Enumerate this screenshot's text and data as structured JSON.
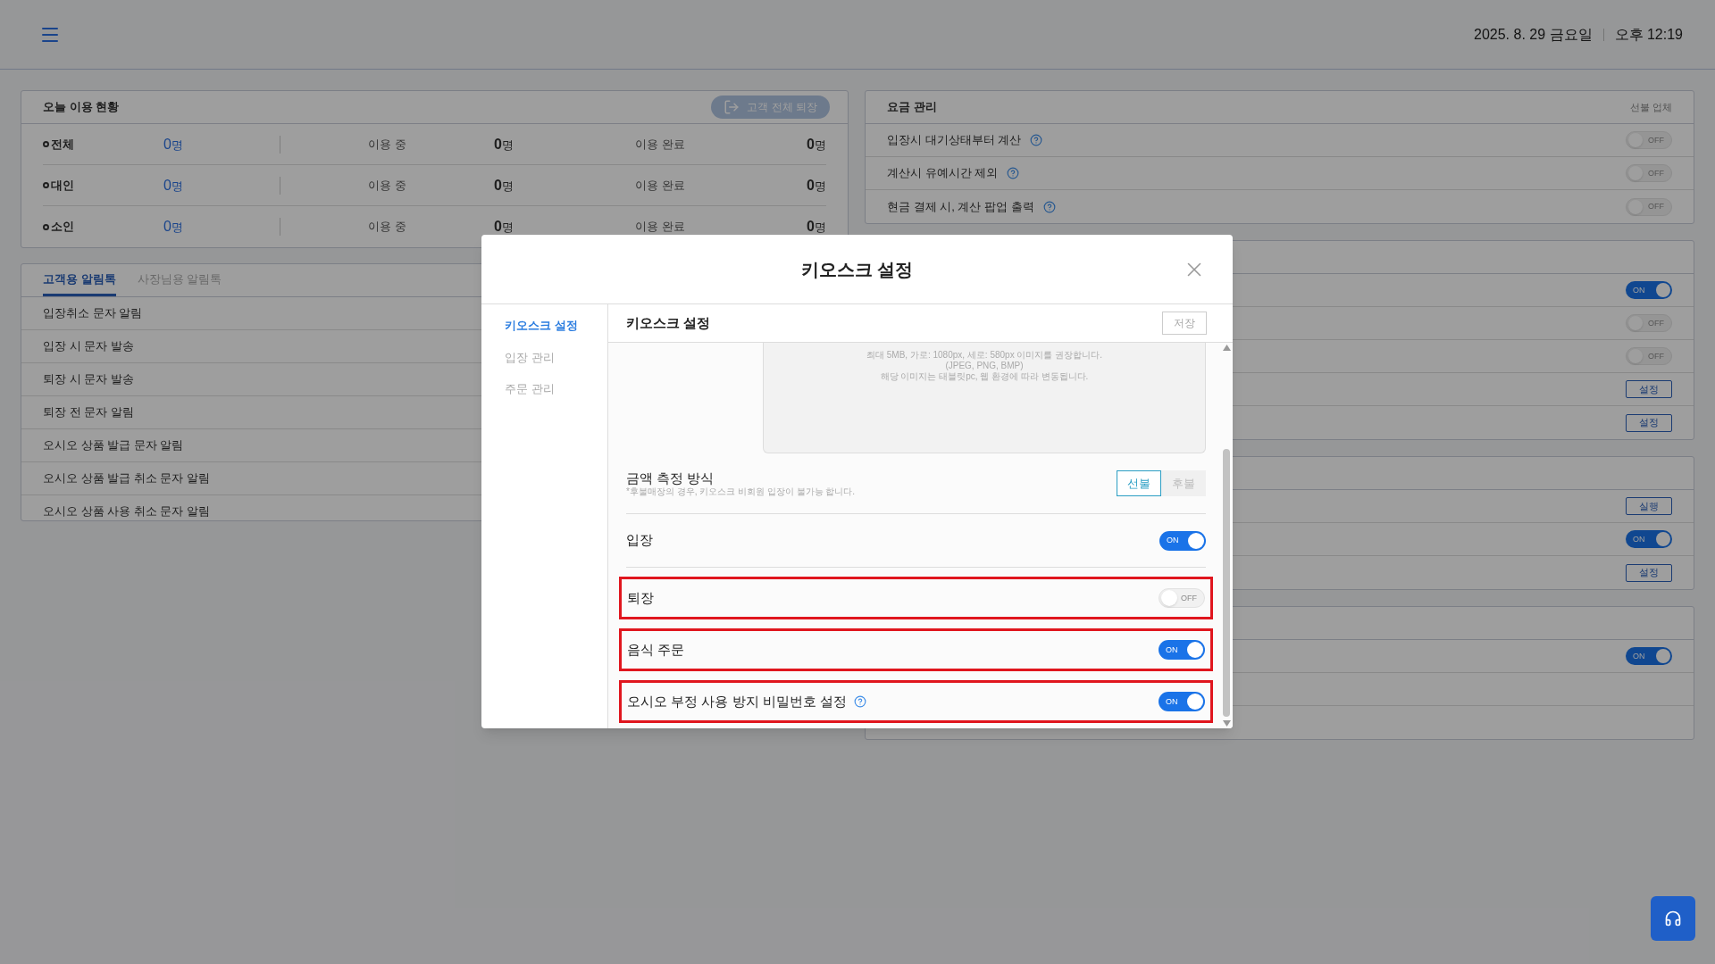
{
  "header": {
    "date": "2025. 8. 29 금요일",
    "time": "오후 12:19"
  },
  "usage_panel": {
    "title": "오늘 이용 현황",
    "exit_all_button": "고객 전체 퇴장",
    "rows": [
      {
        "label": "전체",
        "total_count": "0",
        "total_unit": "명",
        "in_use_label": "이용 중",
        "in_use_count": "0",
        "in_use_unit": "명",
        "done_label": "이용 완료",
        "done_count": "0",
        "done_unit": "명"
      },
      {
        "label": "대인",
        "total_count": "0",
        "total_unit": "명",
        "in_use_label": "이용 중",
        "in_use_count": "0",
        "in_use_unit": "명",
        "done_label": "이용 완료",
        "done_count": "0",
        "done_unit": "명"
      },
      {
        "label": "소인",
        "total_count": "0",
        "total_unit": "명",
        "in_use_label": "이용 중",
        "in_use_count": "0",
        "in_use_unit": "명",
        "done_label": "이용 완료",
        "done_count": "0",
        "done_unit": "명"
      }
    ]
  },
  "notification_panel": {
    "tabs": [
      {
        "label": "고객용 알림톡",
        "selected": true
      },
      {
        "label": "사장님용 알림톡",
        "selected": false
      }
    ],
    "items": [
      "입장취소 문자 알림",
      "입장 시 문자 발송",
      "퇴장 시 문자 발송",
      "퇴장 전 문자 알림",
      "오시오 상품 발급 문자 알림",
      "오시오 상품 발급 취소 문자 알림",
      "오시오 상품 사용 취소 문자 알림"
    ]
  },
  "fee_panel": {
    "title": "요금 관리",
    "note": "선불 업체",
    "rows": [
      {
        "label": "입장시 대기상태부터 계산",
        "help": true,
        "toggle": {
          "on": false,
          "label": "OFF"
        }
      },
      {
        "label": "계산시 유예시간 제외",
        "help": true,
        "toggle": {
          "on": false,
          "label": "OFF"
        }
      },
      {
        "label": "현금 결제 시, 계산 팝업 출력",
        "help": true,
        "toggle": {
          "on": false,
          "label": "OFF"
        }
      }
    ]
  },
  "other_panels": [
    {
      "rows": [
        {
          "kind": "toggle",
          "on": true,
          "label": "ON"
        },
        {
          "kind": "toggle",
          "on": false,
          "label": "OFF"
        },
        {
          "kind": "toggle",
          "on": false,
          "label": "OFF"
        },
        {
          "kind": "button",
          "label": "설정"
        },
        {
          "kind": "button",
          "label": "설정"
        }
      ]
    },
    {
      "rows": [
        {
          "kind": "button",
          "label": "실행"
        },
        {
          "kind": "toggle",
          "on": true,
          "label": "ON"
        },
        {
          "kind": "button",
          "label": "설정"
        }
      ]
    },
    {
      "rows": [
        {
          "kind": "toggle",
          "on": true,
          "label": "ON"
        },
        {
          "kind": "blank"
        },
        {
          "kind": "blank"
        }
      ]
    }
  ],
  "modal": {
    "title": "키오스크 설정",
    "menu": [
      {
        "label": "키오스크 설정",
        "selected": true
      },
      {
        "label": "입장 관리",
        "selected": false
      },
      {
        "label": "주문 관리",
        "selected": false
      }
    ],
    "section_title": "키오스크 설정",
    "save_button": "저장",
    "image_hint": [
      "최대 5MB, 가로: 1080px, 세로: 580px 이미지를 권장합니다.",
      "(JPEG, PNG, BMP)",
      "해당 이미지는 태블릿pc, 웹 환경에 따라 변동됩니다."
    ],
    "pricing": {
      "label": "금액 측정 방식",
      "note": "*후불매장의 경우, 키오스크 비회원 입장이 불가능 합니다.",
      "options": [
        {
          "label": "선불",
          "selected": true
        },
        {
          "label": "후불",
          "selected": false
        }
      ]
    },
    "settings": [
      {
        "label": "입장",
        "help": false,
        "highlighted": false,
        "toggle": {
          "on": true,
          "label": "ON"
        }
      },
      {
        "label": "퇴장",
        "help": false,
        "highlighted": true,
        "toggle": {
          "on": false,
          "label": "OFF"
        }
      },
      {
        "label": "음식 주문",
        "help": false,
        "highlighted": true,
        "toggle": {
          "on": true,
          "label": "ON"
        }
      },
      {
        "label": "오시오 부정 사용 방지 비밀번호 설정",
        "help": true,
        "highlighted": true,
        "toggle": {
          "on": true,
          "label": "ON"
        }
      }
    ]
  }
}
